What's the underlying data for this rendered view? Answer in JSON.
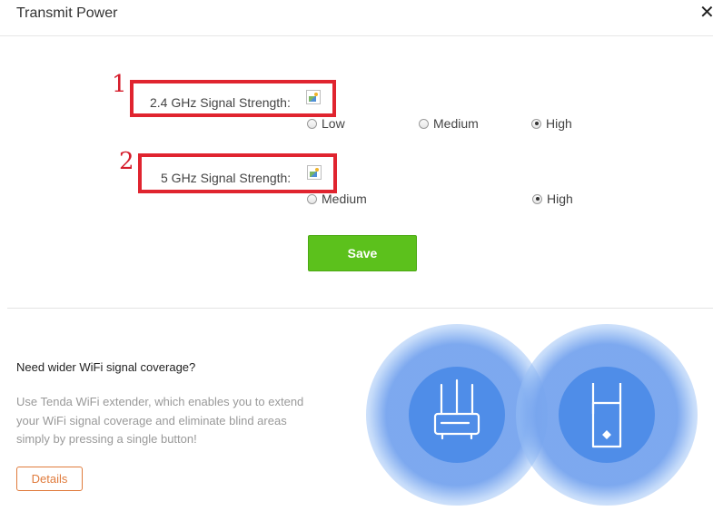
{
  "header": {
    "title": "Transmit Power",
    "close_glyph": "✕"
  },
  "annotations": {
    "callout_1": "1",
    "callout_2": "2"
  },
  "band_24": {
    "label": "2.4 GHz Signal Strength:",
    "options": [
      "Low",
      "Medium",
      "High"
    ],
    "selected": "High"
  },
  "band_5": {
    "label": "5 GHz Signal Strength:",
    "options": [
      "Medium",
      "High"
    ],
    "selected": "High"
  },
  "save_label": "Save",
  "promo": {
    "question": "Need wider WiFi signal coverage?",
    "description": "Use Tenda WiFi extender, which enables you to extend your WiFi signal coverage and eliminate blind areas simply by pressing a single button!",
    "details_label": "Details",
    "icons": [
      "router-icon",
      "extender-icon"
    ]
  },
  "colors": {
    "save_green": "#5cc11c",
    "callout_red": "#e0242f",
    "details_orange": "#e07b3c",
    "device_blue": "#4f8de8"
  }
}
